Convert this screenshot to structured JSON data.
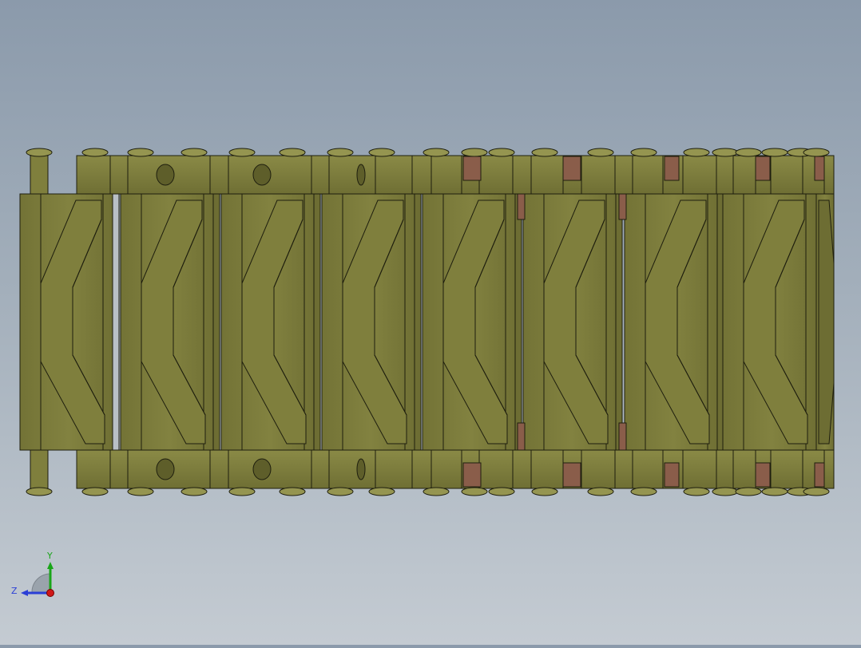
{
  "scene": {
    "background_top": "#8b9aab",
    "background_bottom": "#c4cbd2",
    "part_color": "#7f7f3d",
    "part_shade": "#6d6d33",
    "part_highlight": "#959550",
    "edge_color": "#1e1e0e",
    "joint_color": "#8a5d4a"
  },
  "triad": {
    "y_label": "Y",
    "z_label": "Z",
    "y_color": "#19a519",
    "z_color": "#2b3fd6",
    "x_color": "#d01818"
  }
}
